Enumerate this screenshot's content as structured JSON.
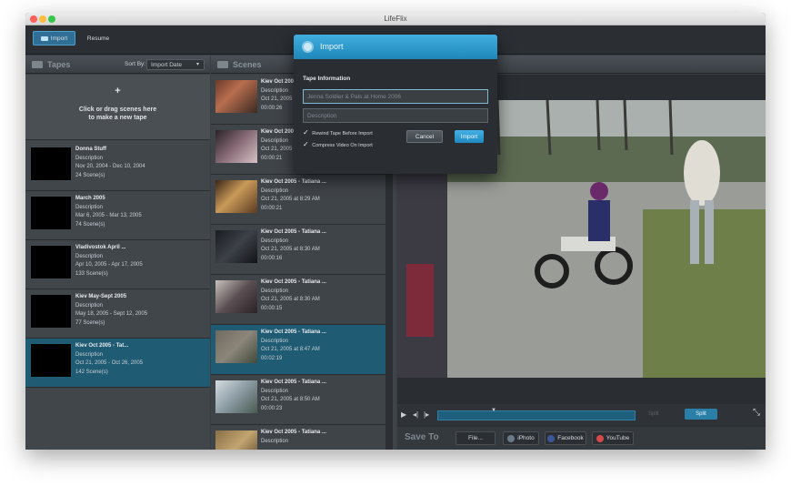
{
  "window": {
    "title": "LifeFlix"
  },
  "toolbar": {
    "import_label": "Import",
    "resume_label": "Resume"
  },
  "tapes_panel": {
    "title": "Tapes",
    "sort_label": "Sort By:",
    "sort_value": "Import Date",
    "new_tape_plus": "+",
    "new_tape_line1": "Click or drag scenes here",
    "new_tape_line2": "to make a new tape",
    "tapes": [
      {
        "name": "Donna Stuff",
        "description": "Description",
        "dates": "Nov 20, 2004 - Dec 10, 2004",
        "scenes": "24 Scene(s)"
      },
      {
        "name": "March 2005",
        "description": "Description",
        "dates": "Mar 6, 2005 - Mar 13, 2005",
        "scenes": "74 Scene(s)"
      },
      {
        "name": "Vladivostok April ...",
        "description": "Description",
        "dates": "Apr 10, 2005 - Apr 17, 2005",
        "scenes": "133 Scene(s)"
      },
      {
        "name": "Kiev May-Sept 2005",
        "description": "Description",
        "dates": "May 18, 2005 - Sept 12, 2005",
        "scenes": "77 Scene(s)"
      },
      {
        "name": "Kiev Oct 2005 - Tat...",
        "description": "Description",
        "dates": "Oct 21, 2005 - Oct 26, 2005",
        "scenes": "142 Scene(s)"
      }
    ]
  },
  "scenes_panel": {
    "title": "Scenes",
    "scenes": [
      {
        "name": "Kiev Oct 200...",
        "description": "Description",
        "date": "Oct 21, 2005 ...",
        "duration": "00:00:26"
      },
      {
        "name": "Kiev Oct 200...",
        "description": "Description",
        "date": "Oct 21, 2005 ...",
        "duration": "00:00:21"
      },
      {
        "name": "Kiev Oct 2005 - Tatiana ...",
        "description": "Description",
        "date": "Oct 21, 2005 at 8:29 AM",
        "duration": "00:00:21"
      },
      {
        "name": "Kiev Oct 2005 - Tatiana ...",
        "description": "Description",
        "date": "Oct 21, 2005 at 8:30 AM",
        "duration": "00:00:16"
      },
      {
        "name": "Kiev Oct 2005 - Tatiana ...",
        "description": "Description",
        "date": "Oct 21, 2005 at 8:30 AM",
        "duration": "00:00:15"
      },
      {
        "name": "Kiev Oct 2005 - Tatiana ...",
        "description": "Description",
        "date": "Oct 21, 2005 at 8:47 AM",
        "duration": "00:02:19"
      },
      {
        "name": "Kiev Oct 2005 - Tatiana ...",
        "description": "Description",
        "date": "Oct 21, 2005 at 8:50 AM",
        "duration": "00:00:23"
      },
      {
        "name": "Kiev Oct 2005 - Tatiana ...",
        "description": "Description",
        "date": "",
        "duration": ""
      }
    ]
  },
  "player": {
    "split_label": "Split",
    "split_dim_label": "Split",
    "save_to": "Save To",
    "file_label": "File...",
    "iphoto_label": "iPhoto",
    "facebook_label": "Facebook",
    "youtube_label": "YouTube"
  },
  "import_dialog": {
    "title": "Import",
    "section_label": "Tape Information",
    "name_placeholder": "Jenna Soldier & Pals at Home 2006",
    "description_placeholder": "Description",
    "rewind_label": "Rewind Tape Before Import",
    "compress_label": "Compress Video On Import",
    "cancel_label": "Cancel",
    "import_label": "Import"
  },
  "colors": {
    "accent": "#1f87b9",
    "selection": "#1f5b73"
  }
}
